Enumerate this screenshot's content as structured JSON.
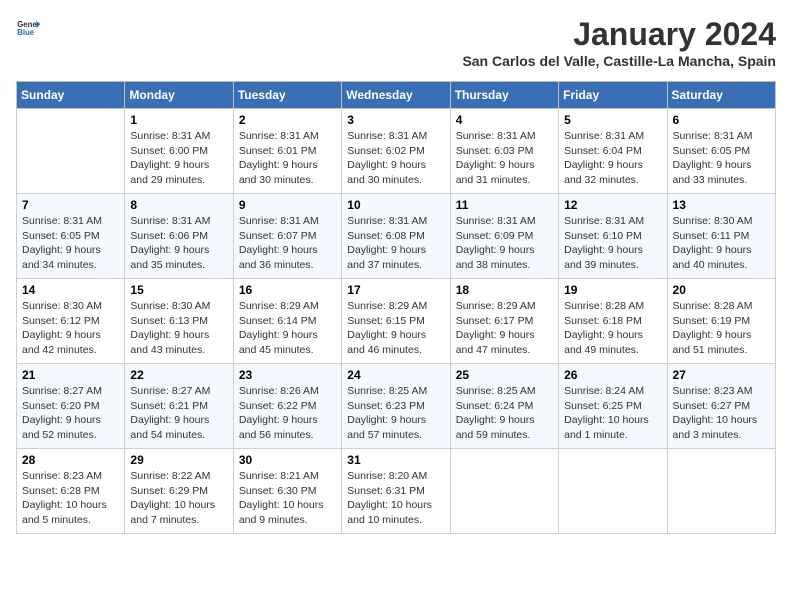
{
  "header": {
    "logo_general": "General",
    "logo_blue": "Blue",
    "month_title": "January 2024",
    "location": "San Carlos del Valle, Castille-La Mancha, Spain"
  },
  "calendar": {
    "days_of_week": [
      "Sunday",
      "Monday",
      "Tuesday",
      "Wednesday",
      "Thursday",
      "Friday",
      "Saturday"
    ],
    "weeks": [
      [
        {
          "day": "",
          "sunrise": "",
          "sunset": "",
          "daylight": ""
        },
        {
          "day": "1",
          "sunrise": "Sunrise: 8:31 AM",
          "sunset": "Sunset: 6:00 PM",
          "daylight": "Daylight: 9 hours and 29 minutes."
        },
        {
          "day": "2",
          "sunrise": "Sunrise: 8:31 AM",
          "sunset": "Sunset: 6:01 PM",
          "daylight": "Daylight: 9 hours and 30 minutes."
        },
        {
          "day": "3",
          "sunrise": "Sunrise: 8:31 AM",
          "sunset": "Sunset: 6:02 PM",
          "daylight": "Daylight: 9 hours and 30 minutes."
        },
        {
          "day": "4",
          "sunrise": "Sunrise: 8:31 AM",
          "sunset": "Sunset: 6:03 PM",
          "daylight": "Daylight: 9 hours and 31 minutes."
        },
        {
          "day": "5",
          "sunrise": "Sunrise: 8:31 AM",
          "sunset": "Sunset: 6:04 PM",
          "daylight": "Daylight: 9 hours and 32 minutes."
        },
        {
          "day": "6",
          "sunrise": "Sunrise: 8:31 AM",
          "sunset": "Sunset: 6:05 PM",
          "daylight": "Daylight: 9 hours and 33 minutes."
        }
      ],
      [
        {
          "day": "7",
          "sunrise": "Sunrise: 8:31 AM",
          "sunset": "Sunset: 6:05 PM",
          "daylight": "Daylight: 9 hours and 34 minutes."
        },
        {
          "day": "8",
          "sunrise": "Sunrise: 8:31 AM",
          "sunset": "Sunset: 6:06 PM",
          "daylight": "Daylight: 9 hours and 35 minutes."
        },
        {
          "day": "9",
          "sunrise": "Sunrise: 8:31 AM",
          "sunset": "Sunset: 6:07 PM",
          "daylight": "Daylight: 9 hours and 36 minutes."
        },
        {
          "day": "10",
          "sunrise": "Sunrise: 8:31 AM",
          "sunset": "Sunset: 6:08 PM",
          "daylight": "Daylight: 9 hours and 37 minutes."
        },
        {
          "day": "11",
          "sunrise": "Sunrise: 8:31 AM",
          "sunset": "Sunset: 6:09 PM",
          "daylight": "Daylight: 9 hours and 38 minutes."
        },
        {
          "day": "12",
          "sunrise": "Sunrise: 8:31 AM",
          "sunset": "Sunset: 6:10 PM",
          "daylight": "Daylight: 9 hours and 39 minutes."
        },
        {
          "day": "13",
          "sunrise": "Sunrise: 8:30 AM",
          "sunset": "Sunset: 6:11 PM",
          "daylight": "Daylight: 9 hours and 40 minutes."
        }
      ],
      [
        {
          "day": "14",
          "sunrise": "Sunrise: 8:30 AM",
          "sunset": "Sunset: 6:12 PM",
          "daylight": "Daylight: 9 hours and 42 minutes."
        },
        {
          "day": "15",
          "sunrise": "Sunrise: 8:30 AM",
          "sunset": "Sunset: 6:13 PM",
          "daylight": "Daylight: 9 hours and 43 minutes."
        },
        {
          "day": "16",
          "sunrise": "Sunrise: 8:29 AM",
          "sunset": "Sunset: 6:14 PM",
          "daylight": "Daylight: 9 hours and 45 minutes."
        },
        {
          "day": "17",
          "sunrise": "Sunrise: 8:29 AM",
          "sunset": "Sunset: 6:15 PM",
          "daylight": "Daylight: 9 hours and 46 minutes."
        },
        {
          "day": "18",
          "sunrise": "Sunrise: 8:29 AM",
          "sunset": "Sunset: 6:17 PM",
          "daylight": "Daylight: 9 hours and 47 minutes."
        },
        {
          "day": "19",
          "sunrise": "Sunrise: 8:28 AM",
          "sunset": "Sunset: 6:18 PM",
          "daylight": "Daylight: 9 hours and 49 minutes."
        },
        {
          "day": "20",
          "sunrise": "Sunrise: 8:28 AM",
          "sunset": "Sunset: 6:19 PM",
          "daylight": "Daylight: 9 hours and 51 minutes."
        }
      ],
      [
        {
          "day": "21",
          "sunrise": "Sunrise: 8:27 AM",
          "sunset": "Sunset: 6:20 PM",
          "daylight": "Daylight: 9 hours and 52 minutes."
        },
        {
          "day": "22",
          "sunrise": "Sunrise: 8:27 AM",
          "sunset": "Sunset: 6:21 PM",
          "daylight": "Daylight: 9 hours and 54 minutes."
        },
        {
          "day": "23",
          "sunrise": "Sunrise: 8:26 AM",
          "sunset": "Sunset: 6:22 PM",
          "daylight": "Daylight: 9 hours and 56 minutes."
        },
        {
          "day": "24",
          "sunrise": "Sunrise: 8:25 AM",
          "sunset": "Sunset: 6:23 PM",
          "daylight": "Daylight: 9 hours and 57 minutes."
        },
        {
          "day": "25",
          "sunrise": "Sunrise: 8:25 AM",
          "sunset": "Sunset: 6:24 PM",
          "daylight": "Daylight: 9 hours and 59 minutes."
        },
        {
          "day": "26",
          "sunrise": "Sunrise: 8:24 AM",
          "sunset": "Sunset: 6:25 PM",
          "daylight": "Daylight: 10 hours and 1 minute."
        },
        {
          "day": "27",
          "sunrise": "Sunrise: 8:23 AM",
          "sunset": "Sunset: 6:27 PM",
          "daylight": "Daylight: 10 hours and 3 minutes."
        }
      ],
      [
        {
          "day": "28",
          "sunrise": "Sunrise: 8:23 AM",
          "sunset": "Sunset: 6:28 PM",
          "daylight": "Daylight: 10 hours and 5 minutes."
        },
        {
          "day": "29",
          "sunrise": "Sunrise: 8:22 AM",
          "sunset": "Sunset: 6:29 PM",
          "daylight": "Daylight: 10 hours and 7 minutes."
        },
        {
          "day": "30",
          "sunrise": "Sunrise: 8:21 AM",
          "sunset": "Sunset: 6:30 PM",
          "daylight": "Daylight: 10 hours and 9 minutes."
        },
        {
          "day": "31",
          "sunrise": "Sunrise: 8:20 AM",
          "sunset": "Sunset: 6:31 PM",
          "daylight": "Daylight: 10 hours and 10 minutes."
        },
        {
          "day": "",
          "sunrise": "",
          "sunset": "",
          "daylight": ""
        },
        {
          "day": "",
          "sunrise": "",
          "sunset": "",
          "daylight": ""
        },
        {
          "day": "",
          "sunrise": "",
          "sunset": "",
          "daylight": ""
        }
      ]
    ]
  }
}
